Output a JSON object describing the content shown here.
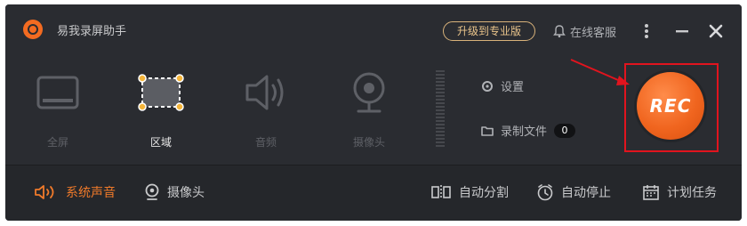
{
  "app": {
    "title": "易我录屏助手",
    "upgrade_label": "升级到专业版",
    "support_label": "在线客服"
  },
  "modes": [
    {
      "label": "全屏",
      "icon": "monitor-icon",
      "active": false
    },
    {
      "label": "区域",
      "icon": "region-select-icon",
      "active": true
    },
    {
      "label": "音频",
      "icon": "speaker-icon",
      "active": false
    },
    {
      "label": "摄像头",
      "icon": "webcam-icon",
      "active": false
    }
  ],
  "side": {
    "settings_label": "设置",
    "recordings_label": "录制文件",
    "recordings_count": "0"
  },
  "rec": {
    "label": "REC",
    "highlight_color": "#e1141e",
    "button_color": "#f0651f"
  },
  "bottom": {
    "system_sound": "系统声音",
    "webcam": "摄像头",
    "auto_split": "自动分割",
    "auto_stop": "自动停止",
    "schedule": "计划任务"
  },
  "colors": {
    "accent": "#f07a2a",
    "background": "#2a2c31"
  }
}
